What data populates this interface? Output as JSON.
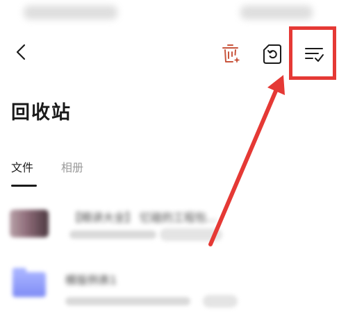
{
  "status_bar": {
    "left_text": "",
    "right_text": ""
  },
  "header": {
    "back_icon": "chevron-left-icon",
    "actions": [
      {
        "name": "clear-trash",
        "icon": "trash-sparkle-icon",
        "color": "#c8553d"
      },
      {
        "name": "restore",
        "icon": "restore-file-icon",
        "color": "#1a1a1a"
      },
      {
        "name": "multi-select",
        "icon": "select-list-icon",
        "color": "#1a1a1a"
      }
    ]
  },
  "page": {
    "title": "回收站"
  },
  "tabs": [
    {
      "label": "文件",
      "active": true
    },
    {
      "label": "相册",
      "active": false
    }
  ],
  "files": [
    {
      "name": "【精讲大全】 忆碰的工程包...",
      "type": "image"
    },
    {
      "name": "模版例表1",
      "type": "folder"
    }
  ],
  "annotation": {
    "color": "#e53935"
  }
}
